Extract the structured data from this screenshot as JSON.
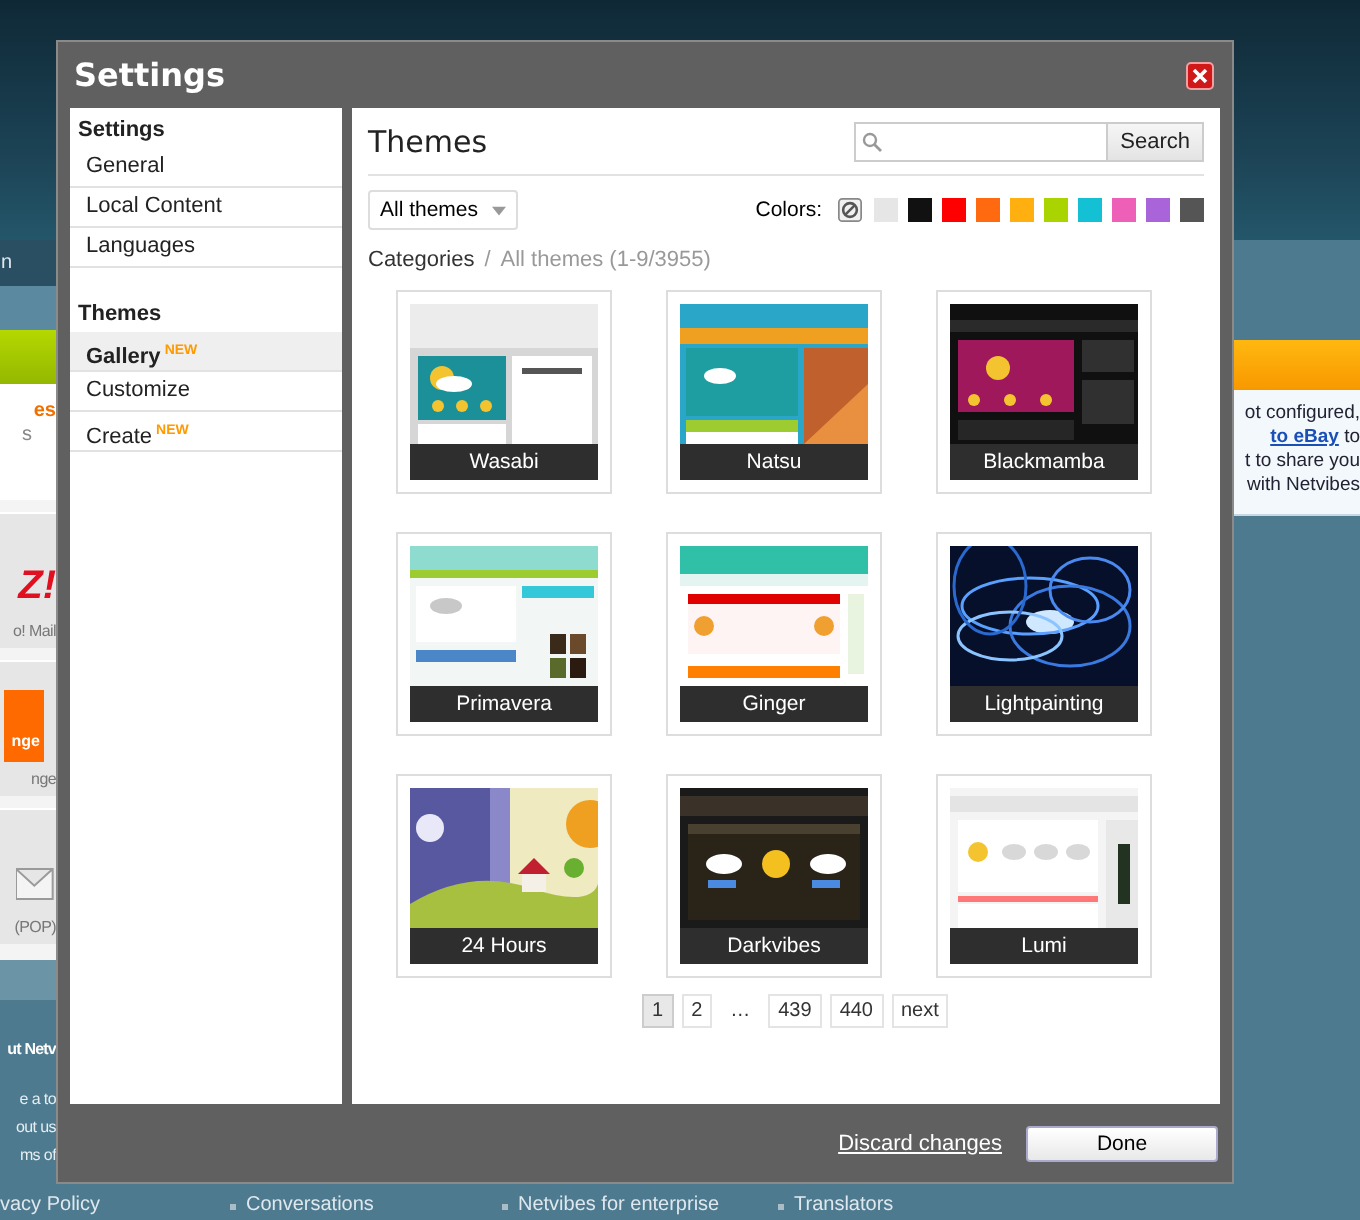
{
  "window": {
    "title": "Settings"
  },
  "sidebar": {
    "sections": [
      {
        "title": "Settings",
        "items": [
          {
            "label": "General",
            "selected": false
          },
          {
            "label": "Local Content",
            "selected": false
          },
          {
            "label": "Languages",
            "selected": false
          }
        ]
      },
      {
        "title": "Themes",
        "items": [
          {
            "label": "Gallery",
            "selected": true,
            "badge": "NEW"
          },
          {
            "label": "Customize",
            "selected": false
          },
          {
            "label": "Create",
            "selected": false,
            "badge": "NEW"
          }
        ]
      }
    ]
  },
  "main": {
    "title": "Themes",
    "search": {
      "button": "Search"
    },
    "filter": "All themes",
    "colors_label": "Colors:",
    "colors": [
      {
        "kind": "none",
        "selected": true
      },
      {
        "kind": "swatch",
        "color": "#e6e6e6",
        "selected": false
      },
      {
        "kind": "swatch",
        "color": "#111111",
        "selected": false
      },
      {
        "kind": "swatch",
        "color": "#ff0000",
        "selected": false
      },
      {
        "kind": "swatch",
        "color": "#ff6a10",
        "selected": false
      },
      {
        "kind": "swatch",
        "color": "#ffb010",
        "selected": false
      },
      {
        "kind": "swatch",
        "color": "#aad400",
        "selected": false
      },
      {
        "kind": "swatch",
        "color": "#14c0d4",
        "selected": false
      },
      {
        "kind": "swatch",
        "color": "#ee5fb8",
        "selected": false
      },
      {
        "kind": "swatch",
        "color": "#a864d8",
        "selected": false
      },
      {
        "kind": "swatch",
        "color": "#555555",
        "selected": false
      }
    ],
    "breadcrumb": {
      "root": "Categories",
      "separator": "/",
      "current": "All themes (1-9/3955)"
    },
    "themes": [
      {
        "name": "Wasabi"
      },
      {
        "name": "Natsu"
      },
      {
        "name": "Blackmamba"
      },
      {
        "name": "Primavera"
      },
      {
        "name": "Ginger"
      },
      {
        "name": "Lightpainting"
      },
      {
        "name": "24 Hours"
      },
      {
        "name": "Darkvibes"
      },
      {
        "name": "Lumi"
      }
    ],
    "pagination": [
      {
        "label": "1",
        "kind": "page",
        "selected": true
      },
      {
        "label": "2",
        "kind": "page",
        "selected": false
      },
      {
        "label": "…",
        "kind": "gap"
      },
      {
        "label": "439",
        "kind": "page",
        "selected": false
      },
      {
        "label": "440",
        "kind": "page",
        "selected": false
      },
      {
        "label": "next",
        "kind": "page",
        "selected": false
      }
    ]
  },
  "footer": {
    "discard": "Discard changes",
    "done": "Done"
  },
  "background": {
    "nav_tab": "n",
    "left": {
      "heading": "es",
      "subtext": "s",
      "services": [
        {
          "kind": "yahoo",
          "logo": "Z!",
          "label": "o! Mail"
        },
        {
          "kind": "orange",
          "logo": "nge",
          "label": "nge"
        },
        {
          "kind": "mail",
          "label": "(POP)"
        }
      ],
      "about_title": "ut Netv",
      "about_links": [
        "e a to",
        "out us",
        "ms of"
      ]
    },
    "right": {
      "lines": [
        {
          "text": "ot configured,"
        },
        {
          "link": "to eBay",
          "text": " to"
        },
        {
          "text": "t to share you"
        },
        {
          "text": "with Netvibes"
        }
      ]
    },
    "footer_links": [
      "vacy Policy",
      "Conversations",
      "Netvibes for enterprise",
      "Translators"
    ]
  }
}
